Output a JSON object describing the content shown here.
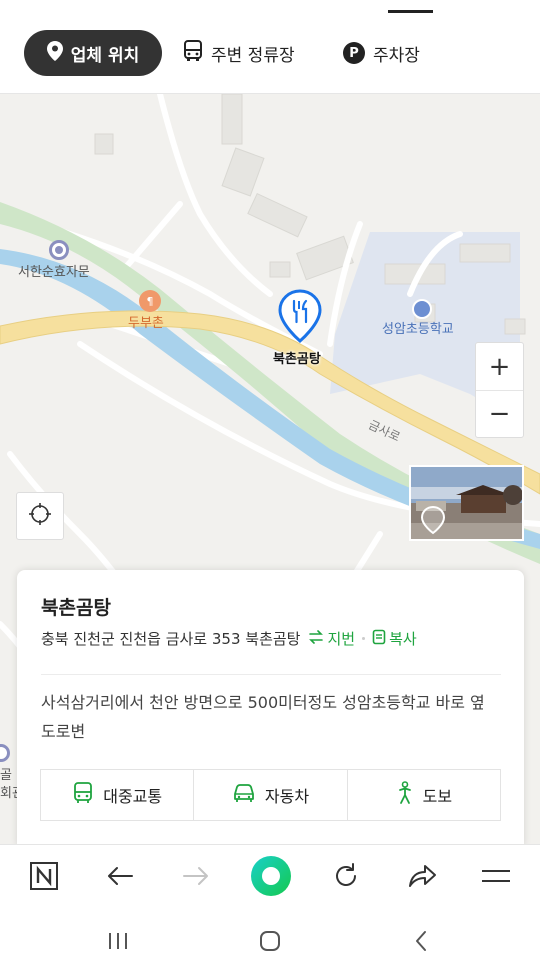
{
  "tabs": [
    {
      "label": "업체 위치",
      "icon": "location-pin-icon",
      "active": true
    },
    {
      "label": "주변 정류장",
      "icon": "bus-icon",
      "active": false
    },
    {
      "label": "주차장",
      "icon": "parking-icon",
      "badge": "P",
      "active": false
    }
  ],
  "map": {
    "labels": {
      "seohan": "서한순효자문",
      "dubuchon": "두부촌",
      "school": "성암초등학교",
      "road": "금사로",
      "left_edge_1": "골",
      "left_edge_2": "회관"
    },
    "pin_label": "북촌곰탕",
    "zoom_in": "+",
    "zoom_out": "−"
  },
  "place": {
    "name": "북촌곰탕",
    "address": "충북 진천군 진천읍 금사로 353 북촌곰탕",
    "jibun_label": "지번",
    "copy_label": "복사",
    "description": "사석삼거리에서 천안 방면으로 500미터정도 성암초등학교 바로 옆 도로변",
    "actions": [
      {
        "label": "대중교통",
        "icon": "bus-icon"
      },
      {
        "label": "자동차",
        "icon": "car-icon"
      },
      {
        "label": "도보",
        "icon": "walk-icon"
      }
    ]
  },
  "colors": {
    "accent_green": "#1fa43f",
    "pin_blue": "#1a73e8",
    "active_tab": "#333333"
  }
}
